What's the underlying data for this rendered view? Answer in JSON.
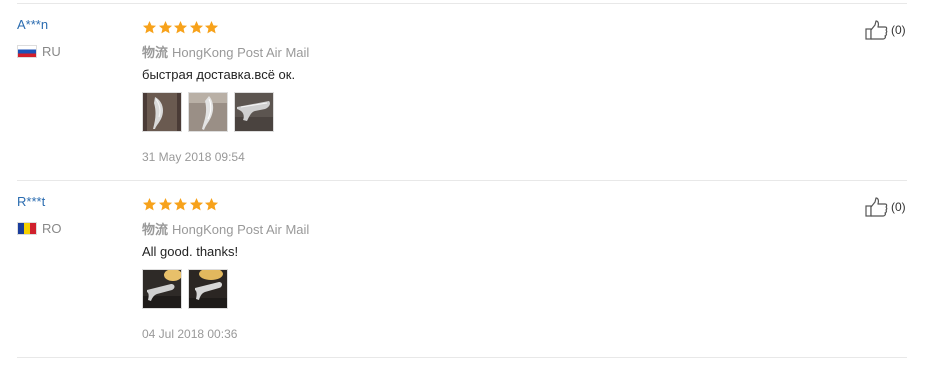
{
  "reviews": [
    {
      "user": "A***n",
      "country_code": "RU",
      "flag_icon": "russia-flag-icon",
      "rating": 5,
      "shipping_label": "物流",
      "shipping_method": "HongKong Post Air Mail",
      "text": "быстрая доставка.всё ок.",
      "photos": [
        "knife-photo-1",
        "knife-photo-2",
        "knife-photo-3"
      ],
      "date": "31 May 2018 09:54",
      "useful_count": "(0)"
    },
    {
      "user": "R***t",
      "country_code": "RO",
      "flag_icon": "romania-flag-icon",
      "rating": 5,
      "shipping_label": "物流",
      "shipping_method": "HongKong Post Air Mail",
      "text": "All good. thanks!",
      "photos": [
        "knife-photo-4",
        "knife-photo-5"
      ],
      "date": "04 Jul 2018 00:36",
      "useful_count": "(0)"
    }
  ],
  "colors": {
    "star": "#f7a21b",
    "username": "#2b6cb0",
    "muted": "#999999"
  }
}
